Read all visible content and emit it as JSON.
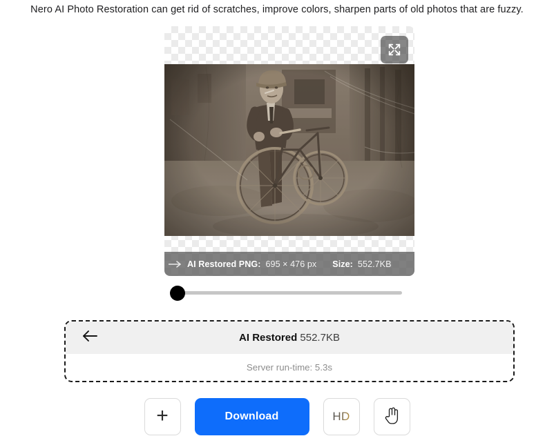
{
  "headline": "Nero AI Photo Restoration can get rid of scratches, improve colors, sharpen parts of old photos that are fuzzy.",
  "preview": {
    "expand_icon": "expand-arrows-icon",
    "caption": {
      "arrow_icon": "arrow-right-icon",
      "label": "AI Restored PNG:",
      "dimensions": "695 × 476 px",
      "size_label": "Size:",
      "size_value": "552.7KB"
    },
    "photo_alt": "Sepia photograph of a boy in a cap standing with a bicycle in an alley"
  },
  "comparison_slider": {
    "name": "before-after-slider",
    "value": 0,
    "min": 0,
    "max": 100
  },
  "result_panel": {
    "back_icon": "arrow-left-icon",
    "title_bold": "AI Restored",
    "title_size": "552.7KB",
    "subtitle": "Server run-time: 5.3s"
  },
  "actions": {
    "add_icon": "plus-icon",
    "add_label": "+",
    "download_label": "Download",
    "hd_label": "HD",
    "hand_icon": "hand-pointer-icon"
  },
  "colors": {
    "accent_blue": "#0e6dfb",
    "panel_header_gray": "#f0f0f0",
    "slider_track": "#c6c6c6",
    "caption_overlay": "rgba(92,92,92,0.78)"
  }
}
